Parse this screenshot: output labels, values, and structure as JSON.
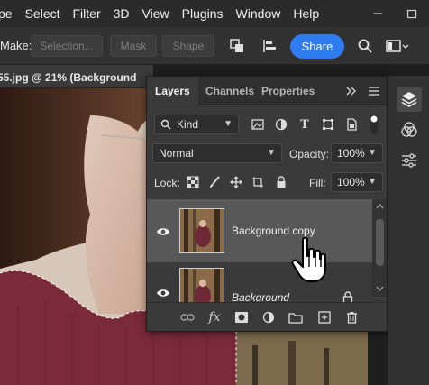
{
  "menubar": {
    "items": [
      "pe",
      "Select",
      "Filter",
      "3D",
      "View",
      "Plugins",
      "Window",
      "Help"
    ],
    "window_controls": [
      "minimize-icon",
      "restore-icon"
    ]
  },
  "options_bar": {
    "make_label": "Make:",
    "selection_label": "Selection...",
    "mask_label": "Mask",
    "shape_label": "Shape",
    "share_label": "Share"
  },
  "document": {
    "tab_title": "55.jpg @ 21% (Background"
  },
  "layers_panel": {
    "tabs": [
      "Layers",
      "Channels",
      "Properties"
    ],
    "active_tab": "Layers",
    "filter_kind": "Kind",
    "blend_mode": "Normal",
    "opacity_label": "Opacity:",
    "opacity_value": "100%",
    "lock_label": "Lock:",
    "fill_label": "Fill:",
    "fill_value": "100%",
    "layers": [
      {
        "name": "Background copy",
        "selected": true,
        "locked": false
      },
      {
        "name": "Background",
        "selected": false,
        "locked": true
      }
    ],
    "bottom_icons": [
      "link-icon",
      "fx-icon",
      "mask-icon",
      "adjustment-icon",
      "folder-icon",
      "new-layer-icon",
      "trash-icon"
    ],
    "fx_label": "fx"
  },
  "colors": {
    "accent": "#2d7cf0",
    "panel_bg": "#3a3a3a",
    "selected_layer": "#585858",
    "sweater": "#7a2a3a"
  }
}
